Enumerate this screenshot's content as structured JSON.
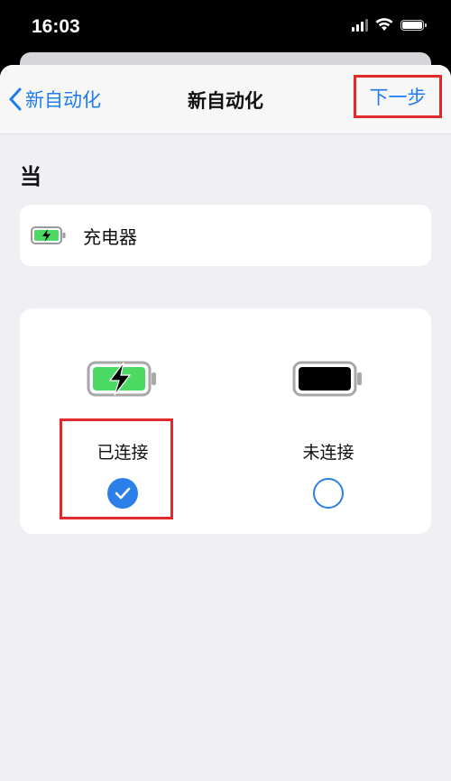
{
  "status_bar": {
    "time": "16:03"
  },
  "nav": {
    "back_label": "新自动化",
    "title": "新自动化",
    "next_label": "下一步"
  },
  "section": {
    "when_label": "当"
  },
  "trigger": {
    "label": "充电器"
  },
  "options": [
    {
      "label": "已连接",
      "selected": true
    },
    {
      "label": "未连接",
      "selected": false
    }
  ],
  "colors": {
    "accent": "#1f7cf0",
    "highlight": "#e0292b",
    "battery_green": "#4cd964"
  }
}
